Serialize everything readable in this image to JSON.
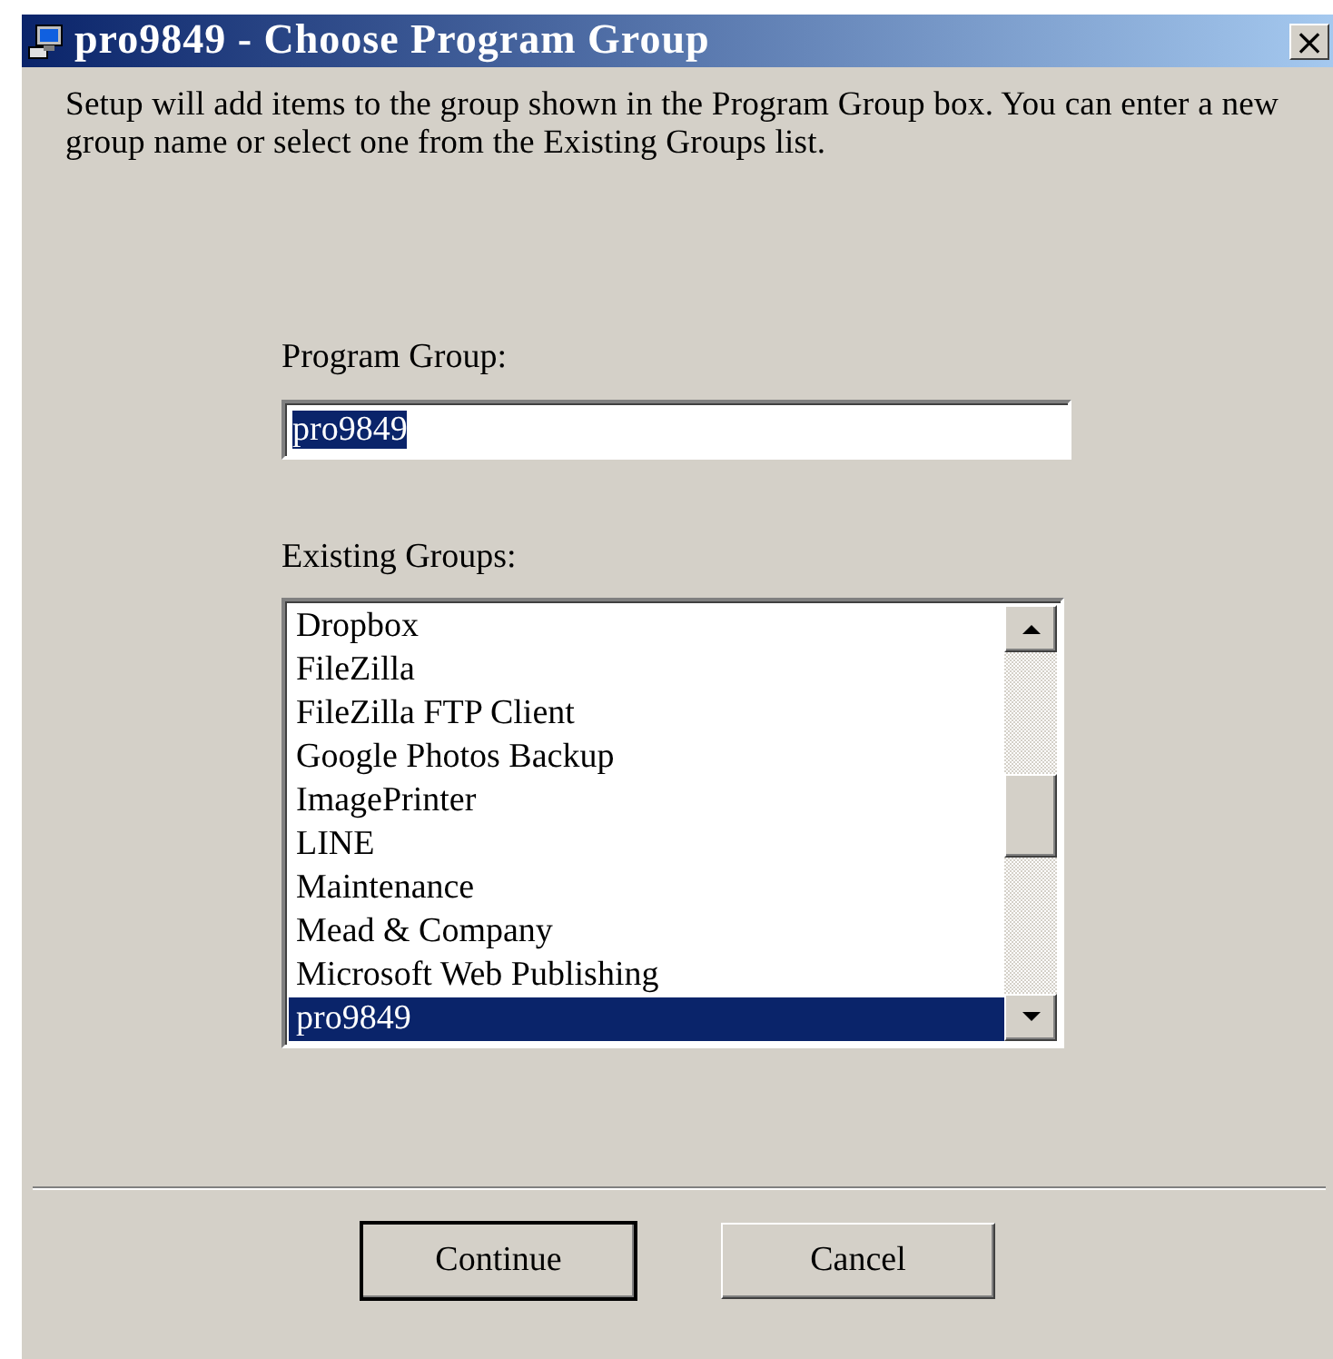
{
  "window": {
    "title": "pro9849 - Choose Program Group",
    "close": "×"
  },
  "description": "Setup will add items to the group shown in the Program Group box. You can enter a new group name or select one from the Existing Groups list.",
  "program_group": {
    "label": "Program Group:",
    "value": "pro9849",
    "value_selected": true
  },
  "existing_groups": {
    "label": "Existing Groups:",
    "items": [
      {
        "name": "Dropbox",
        "selected": false
      },
      {
        "name": "FileZilla",
        "selected": false
      },
      {
        "name": "FileZilla FTP Client",
        "selected": false
      },
      {
        "name": "Google Photos Backup",
        "selected": false
      },
      {
        "name": "ImagePrinter",
        "selected": false
      },
      {
        "name": "LINE",
        "selected": false
      },
      {
        "name": "Maintenance",
        "selected": false
      },
      {
        "name": "Mead & Company",
        "selected": false
      },
      {
        "name": "Microsoft Web Publishing",
        "selected": false
      },
      {
        "name": "pro9849",
        "selected": true
      }
    ]
  },
  "buttons": [
    {
      "label": "Continue",
      "default": true
    },
    {
      "label": "Cancel",
      "default": false
    }
  ]
}
